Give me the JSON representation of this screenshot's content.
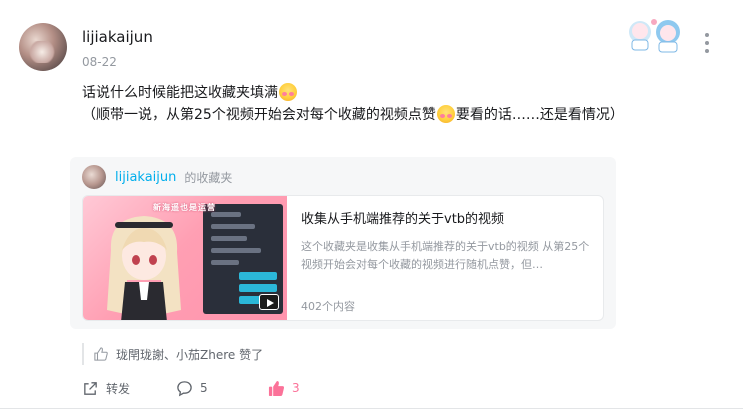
{
  "post": {
    "username": "lijiakaijun",
    "date": "08-22",
    "text_line1": "话说什么时候能把这收藏夹填满",
    "text_line2a": "（顺带一说，从第25个视频开始会对每个收藏的视频点赞",
    "text_line2b": "要看的话……还是看情况）"
  },
  "card": {
    "username": "lijiakaijun",
    "suffix": "的收藏夹",
    "title": "收集从手机端推荐的关于vtb的视频",
    "description": "这个收藏夹是收集从手机端推荐的关于vtb的视频 从第25个视频开始会对每个收藏的视频进行随机点赞，但…",
    "count": "402个内容",
    "cover_text": "新海遥也是运营"
  },
  "likes": {
    "text": "珑閈珑謝、小茄Zhere 赞了"
  },
  "actions": {
    "share": "转发",
    "comment": "5",
    "like": "3"
  },
  "colors": {
    "link": "#00aeec",
    "accent": "#fb7299",
    "muted": "#9499a0"
  },
  "icons": [
    "more-icon",
    "share-icon",
    "comment-icon",
    "like-icon",
    "thumb-icon",
    "play-icon",
    "emoji-icon"
  ]
}
